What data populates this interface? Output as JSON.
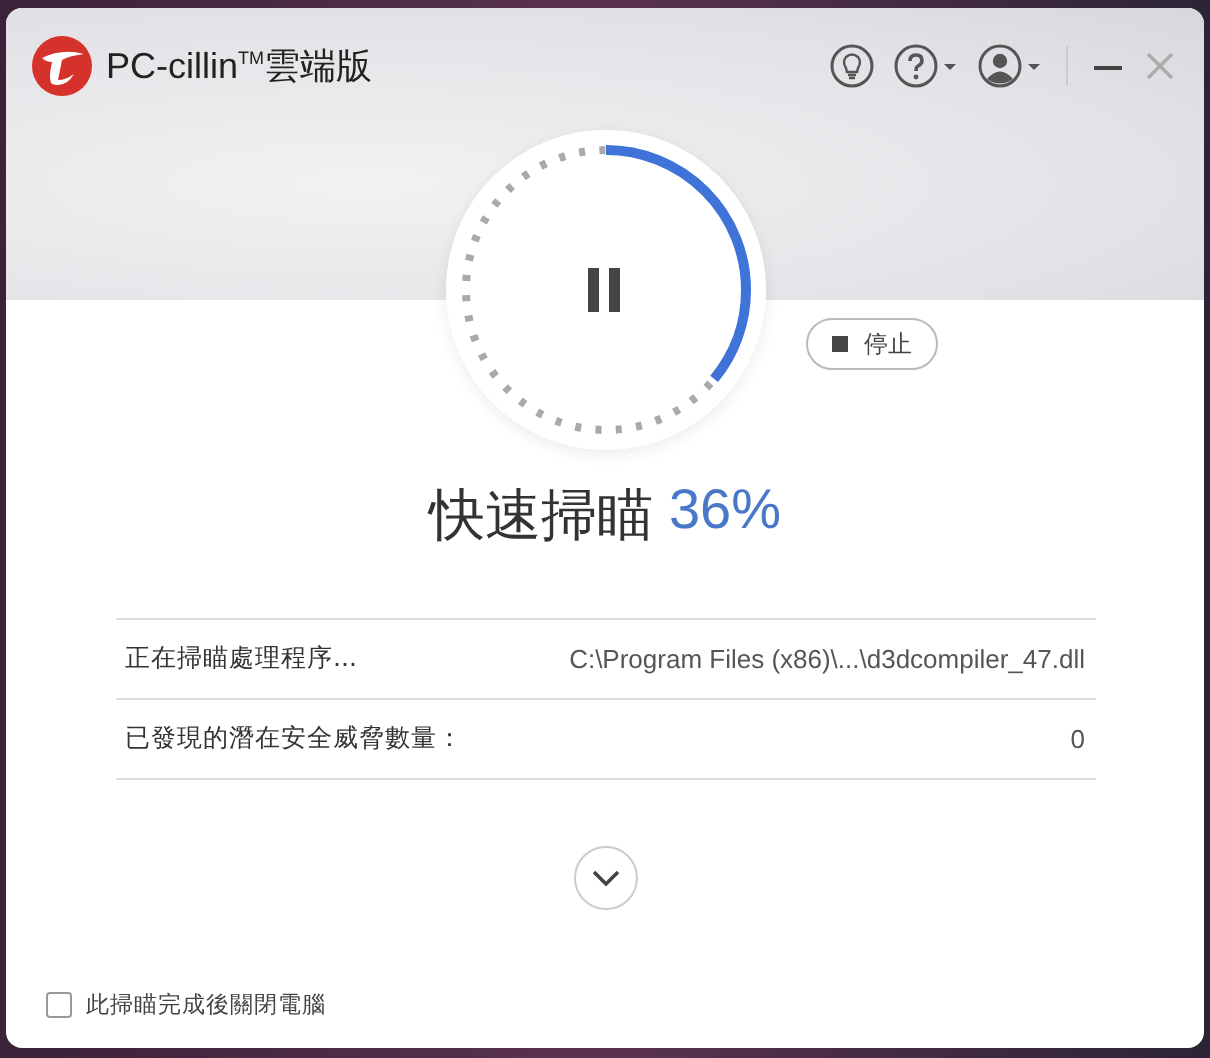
{
  "app": {
    "title": "PC-cillin$^{TM}$雲端版"
  },
  "scan": {
    "title": "快速掃瞄",
    "percent": "36%",
    "level": 0.36
  },
  "stop_button": {
    "label": "停止"
  },
  "details": [
    {
      "label": "正在掃瞄處理程序...",
      "value": "C:\\Program Files (x86)\\...\\d3dcompiler_47.dll"
    },
    {
      "label": "已發現的潛在安全威脅數量：",
      "value": "0"
    }
  ],
  "shutdown_option": {
    "label": "此掃瞄完成後關閉電腦",
    "checked": false
  }
}
